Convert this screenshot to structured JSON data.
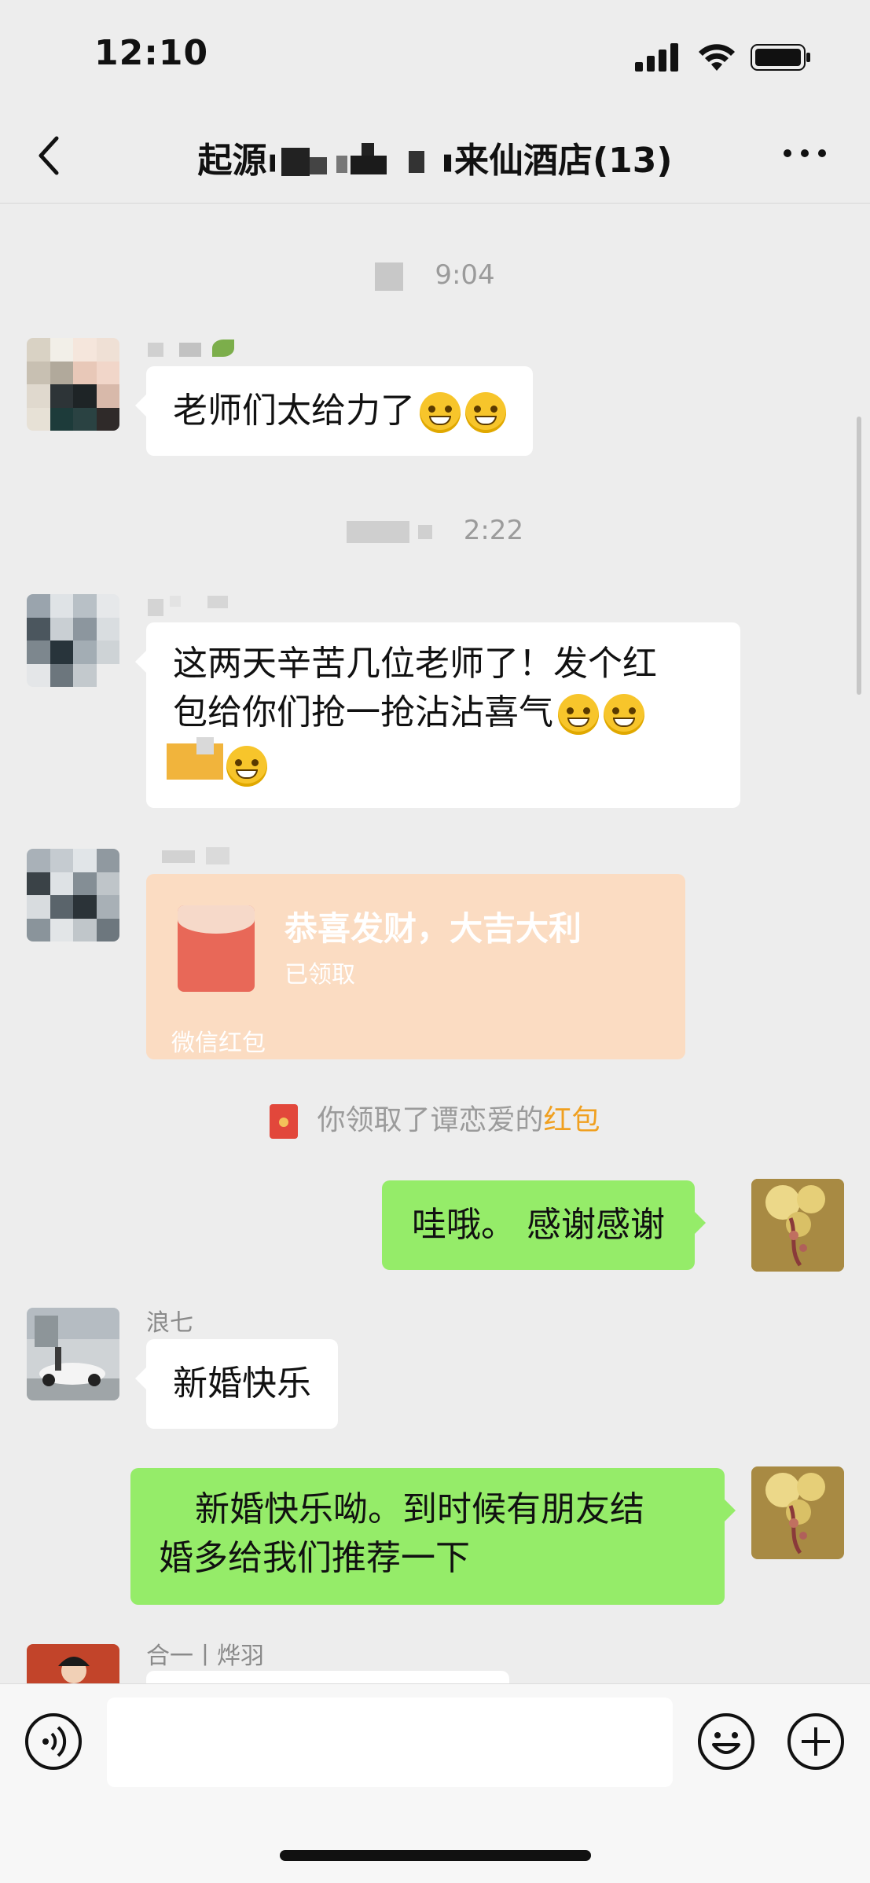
{
  "status_bar": {
    "time": "12:10"
  },
  "header": {
    "title": "起源▪▪▪▪▪▪▪▪来仙酒店(13)"
  },
  "messages": {
    "ts1": "9:04",
    "m1": {
      "text": "老师们太给力了"
    },
    "ts2": "2:22",
    "m2": {
      "line1": "这两天辛苦几位老师了！发个红",
      "line2": "包给你们抢一抢沾沾喜气"
    },
    "red_packet": {
      "title": "恭喜发财，大吉大利",
      "status": "已领取",
      "footer": "微信红包"
    },
    "system": {
      "prefix": "你领取了谭恋爱的",
      "link": "红包"
    },
    "m3": {
      "text": "哇哦。 感谢感谢"
    },
    "m4": {
      "sender": "浪七",
      "text": "新婚快乐"
    },
    "m5": {
      "line1": "新婚快乐呦。到时候有朋友结",
      "line2": "婚多给我们推荐一下"
    },
    "m6": {
      "sender": "合一丨烨羽"
    }
  },
  "input": {
    "value": ""
  },
  "colors": {
    "bg": "#ededed",
    "green_bubble": "#95ec69",
    "red_packet": "#fbdcc2",
    "link": "#f0a020"
  }
}
